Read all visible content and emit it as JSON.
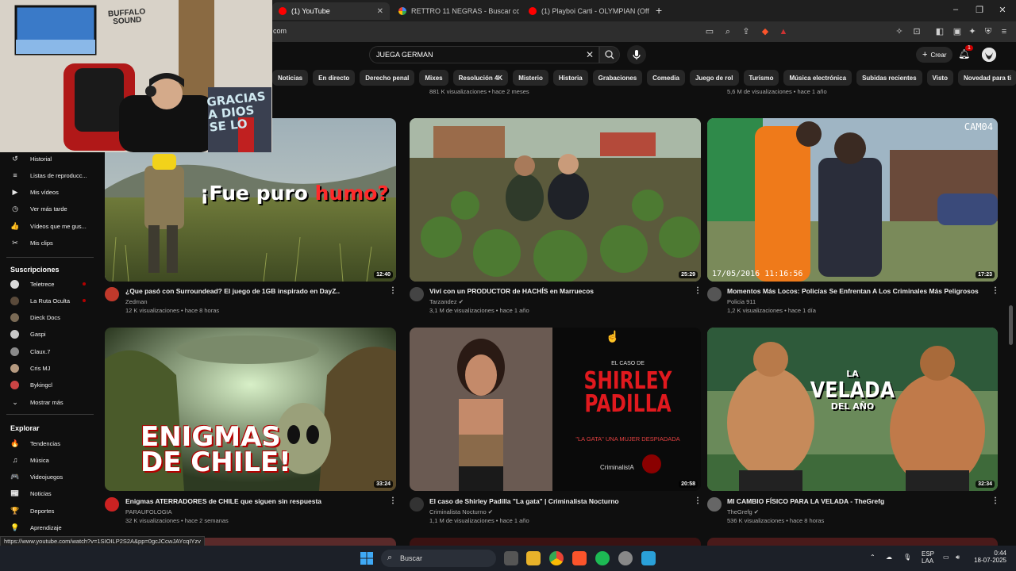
{
  "browser": {
    "tabs": [
      {
        "label": "(1) YouTube",
        "active": true
      },
      {
        "label": "RETTRO 11 NEGRAS - Buscar con Go",
        "active": false
      },
      {
        "label": "(1) Playboi Carti - OLYMPIAN (Official",
        "active": false
      }
    ],
    "url_fragment": "com",
    "new_tab": "+"
  },
  "header": {
    "search_value": "JUEGA GERMAN",
    "create_label": "Crear",
    "notif_count": "1"
  },
  "chips": [
    "Noticias",
    "En directo",
    "Derecho penal",
    "Mixes",
    "Resolución 4K",
    "Misterio",
    "Historia",
    "Grabaciones",
    "Comedia",
    "Juego de rol",
    "Turismo",
    "Música electrónica",
    "Subidas recientes",
    "Visto",
    "Novedad para ti"
  ],
  "toprow": {
    "col2_meta": "881 K visualizaciones • hace 2 meses",
    "col3_meta": "5,6 M de visualizaciones • hace 1 año"
  },
  "sidebar": {
    "you_items": [
      {
        "label": "Historial",
        "icon": "history-icon",
        "glyph": "↺"
      },
      {
        "label": "Listas de reproducc...",
        "icon": "playlist-icon",
        "glyph": "≡"
      },
      {
        "label": "Mis vídeos",
        "icon": "video-icon",
        "glyph": "▶"
      },
      {
        "label": "Ver más tarde",
        "icon": "clock-icon",
        "glyph": "◷"
      },
      {
        "label": "Vídeos que me gus...",
        "icon": "like-icon",
        "glyph": "👍"
      },
      {
        "label": "Mis clips",
        "icon": "scissors-icon",
        "glyph": "✂"
      }
    ],
    "subs_title": "Suscripciones",
    "subs": [
      {
        "label": "Teletrece",
        "color": "#d9d9d9",
        "live": true
      },
      {
        "label": "La Ruta Oculta",
        "color": "#5a4a3a",
        "live": true
      },
      {
        "label": "Dieck Docs",
        "color": "#7a6a55",
        "live": false
      },
      {
        "label": "Gaspi",
        "color": "#c8c8c8",
        "live": false
      },
      {
        "label": "Claux.7",
        "color": "#8a8a8a",
        "live": false
      },
      {
        "label": "Cris MJ",
        "color": "#b59a80",
        "live": false
      },
      {
        "label": "Bykingcl",
        "color": "#cc4444",
        "live": false
      }
    ],
    "show_more": "Mostrar más",
    "explore_title": "Explorar",
    "explore": [
      {
        "label": "Tendencias",
        "icon": "trending-icon",
        "glyph": "🔥"
      },
      {
        "label": "Música",
        "icon": "music-icon",
        "glyph": "♫"
      },
      {
        "label": "Videojuegos",
        "icon": "gamepad-icon",
        "glyph": "🎮"
      },
      {
        "label": "Noticias",
        "icon": "news-icon",
        "glyph": "📰"
      },
      {
        "label": "Deportes",
        "icon": "trophy-icon",
        "glyph": "🏆"
      },
      {
        "label": "Aprendizaje",
        "icon": "bulb-icon",
        "glyph": "💡"
      }
    ]
  },
  "videos": [
    {
      "title": "¿Que pasó con Surroundead? El juego de 1GB inspirado en DayZ..",
      "channel": "Zedman",
      "meta": "12 K visualizaciones • hace 8 horas",
      "duration": "12:40",
      "thumb_text_a": "¡Fue puro ",
      "thumb_text_b": "humo?",
      "avatar_color": "#c0392b"
    },
    {
      "title": "Viví con un PRODUCTOR de HACHÍS en Marruecos",
      "channel": "Tarzandez",
      "meta": "3,1 M de visualizaciones • hace 1 año",
      "duration": "25:29",
      "verified": true,
      "avatar_color": "#444"
    },
    {
      "title": "Momentos Más Locos: Policías Se Enfrentan A Los Criminales Más Peligrosos",
      "channel": "Policia 911",
      "meta": "1,2 K visualizaciones • hace 1 día",
      "duration": "17:23",
      "thumb_stamp": "17/05/2016 11:16:56",
      "thumb_cam": "CAM04",
      "avatar_color": "#555"
    },
    {
      "title": "Enigmas ATERRADORES de CHILE que siguen sin respuesta",
      "channel": "PARAUFOLOGIA",
      "meta": "32 K visualizaciones • hace 2 semanas",
      "duration": "33:24",
      "thumb_text_a": "ENIGMAS",
      "thumb_text_b": "DE CHILE!",
      "avatar_color": "#cc2222"
    },
    {
      "title": "El caso de Shirley Padilla \"La gata\" | Criminalista Nocturno",
      "channel": "Criminalista Nocturno",
      "meta": "1,1 M de visualizaciones • hace 1 año",
      "duration": "20:58",
      "verified": true,
      "thumb_small": "EL CASO DE",
      "thumb_big1": "SHIRLEY",
      "thumb_big2": "PADILLA",
      "thumb_sub": "\"LA GATA\" UNA MUJER DESPIADADA",
      "thumb_logo": "CriminalistA",
      "avatar_color": "#333"
    },
    {
      "title": "MI CAMBIO FÍSICO PARA LA VELADA - TheGrefg",
      "channel": "TheGrefg",
      "meta": "536 K visualizaciones • hace 8 horas",
      "duration": "32:34",
      "verified": true,
      "thumb_text_a": "LA",
      "thumb_text_b": "VELADA",
      "thumb_text_c": "DEL AÑO",
      "avatar_color": "#666"
    }
  ],
  "webcam": {
    "poster_text": "BUFFALO SOUND",
    "wall_text_1": "GRACIAS",
    "wall_text_2": "A DIOS",
    "wall_text_3": "SE LO"
  },
  "status_url": "https://www.youtube.com/watch?v=1SIOILP2S2A&pp=0gcJCcwJAYcqIYzv",
  "taskbar": {
    "search_label": "Buscar",
    "lang": "ESP",
    "lang_sub": "LAA",
    "time": "0:44",
    "date": "18-07-2025"
  },
  "colors": {
    "accent": "#ff0000",
    "bg": "#0f0f0f",
    "chip": "#272727"
  }
}
